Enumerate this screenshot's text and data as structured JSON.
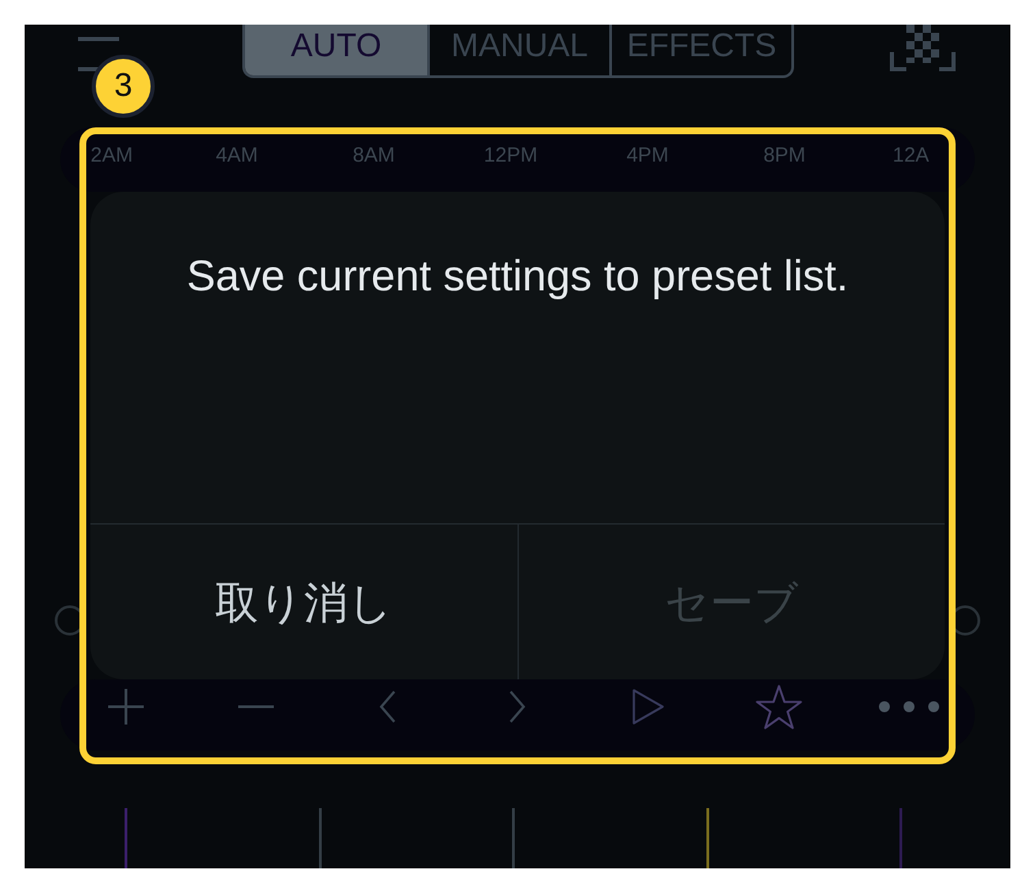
{
  "mode_tabs": [
    {
      "label": "AUTO",
      "selected": true
    },
    {
      "label": "MANUAL",
      "selected": false
    },
    {
      "label": "EFFECTS",
      "selected": false
    }
  ],
  "timeline": {
    "labels": [
      "2AM",
      "4AM",
      "8AM",
      "12PM",
      "4PM",
      "8PM",
      "12A"
    ]
  },
  "dialog": {
    "message": "Save current settings to preset list.",
    "buttons": [
      {
        "label": "取り消し",
        "disabled": false
      },
      {
        "label": "セーブ",
        "disabled": true
      }
    ]
  },
  "tutorial": {
    "step": "3"
  }
}
